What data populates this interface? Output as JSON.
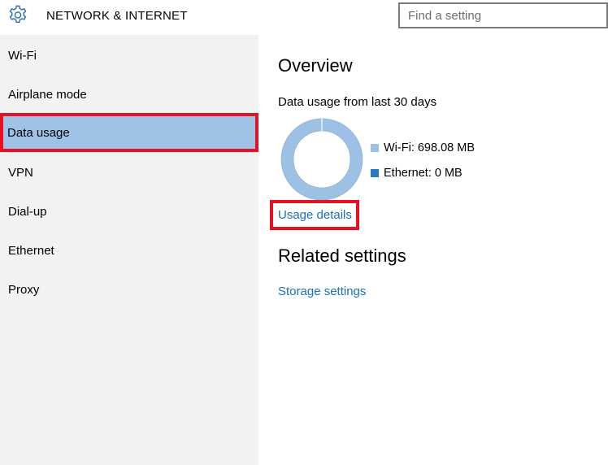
{
  "header": {
    "icon": "gear-icon",
    "title": "NETWORK & INTERNET",
    "search_placeholder": "Find a setting"
  },
  "sidebar": {
    "items": [
      {
        "label": "Wi-Fi",
        "selected": false
      },
      {
        "label": "Airplane mode",
        "selected": false
      },
      {
        "label": "Data usage",
        "selected": true
      },
      {
        "label": "VPN",
        "selected": false
      },
      {
        "label": "Dial-up",
        "selected": false
      },
      {
        "label": "Ethernet",
        "selected": false
      },
      {
        "label": "Proxy",
        "selected": false
      }
    ]
  },
  "main": {
    "overview_title": "Overview",
    "usage_caption": "Data usage from last 30 days",
    "legend": [
      {
        "label": "Wi-Fi: 698.08 MB",
        "color": "#9dc0e5"
      },
      {
        "label": "Ethernet: 0 MB",
        "color": "#2b79c2"
      }
    ],
    "usage_details_link": "Usage details",
    "related_title": "Related settings",
    "storage_link": "Storage settings"
  },
  "colors": {
    "accent": "#1a6fbf",
    "selection_bg": "#9ec3e6",
    "highlight_border": "#e81123",
    "sidebar_bg": "#f2f2f2"
  }
}
